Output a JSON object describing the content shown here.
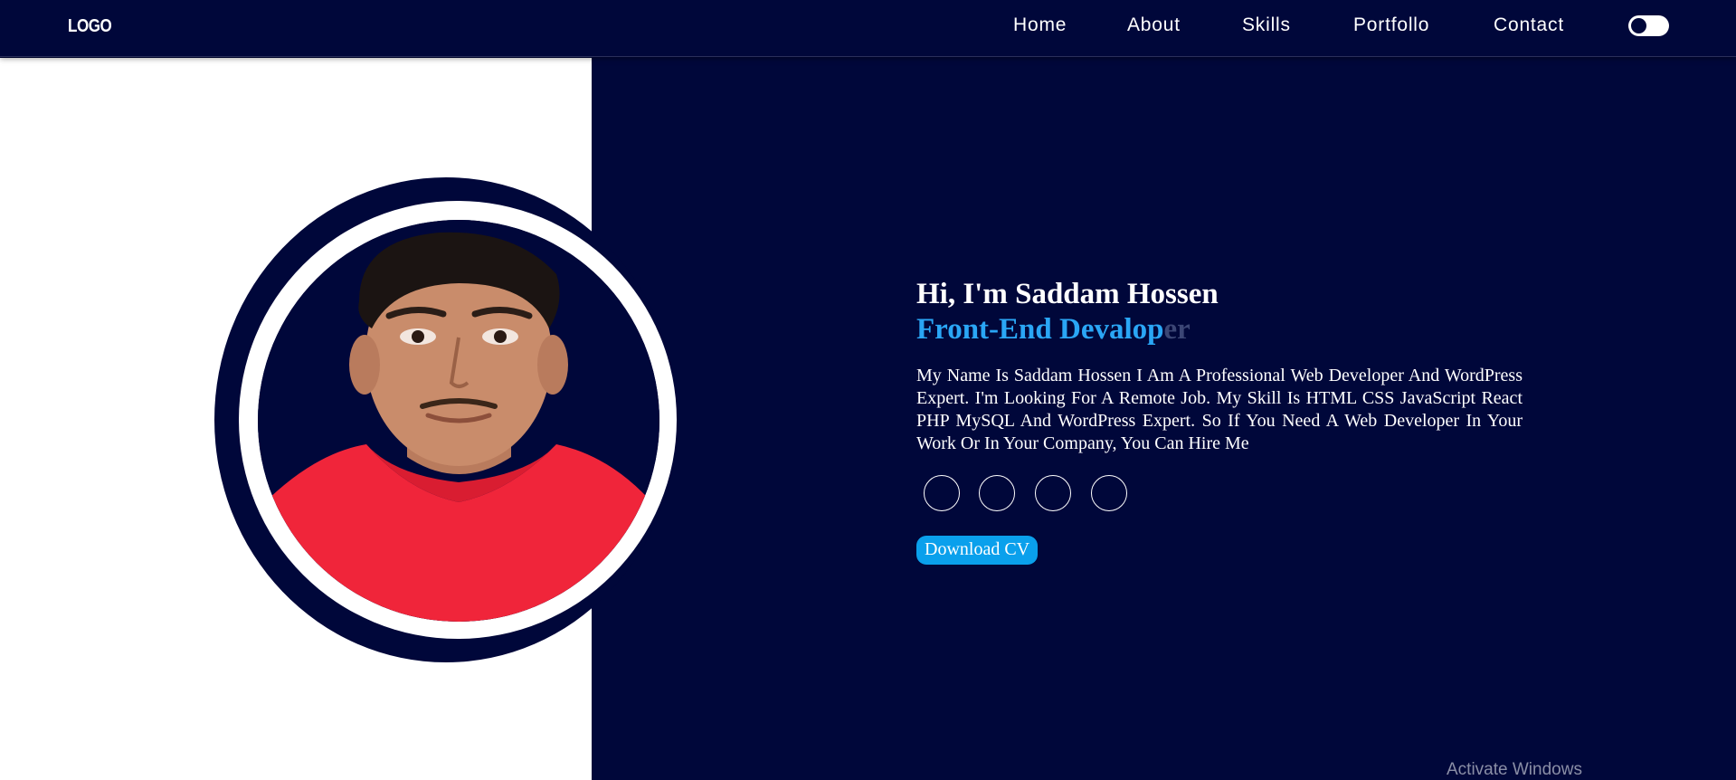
{
  "nav": {
    "logo": "LOGO",
    "links": [
      "Home",
      "About",
      "Skills",
      "Portfollo",
      "Contact"
    ],
    "theme_toggle_icon": "toggle-switch-icon"
  },
  "hero": {
    "greeting": "Hi, I'm Saddam Hossen",
    "role_typed": "Front-End Devalop",
    "role_faded": "er",
    "bio": "My Name Is Saddam Hossen I Am A Professional Web Developer And WordPress Expert. I'm Looking For A Remote Job. My Skill Is HTML CSS JavaScript React PHP MySQL And WordPress Expert. So If You Need A Web Developer In Your Work Or In Your Company, You Can Hire Me",
    "social_icons": [
      "social-icon",
      "social-icon",
      "social-icon",
      "social-icon"
    ],
    "cv_button": "Download CV"
  },
  "colors": {
    "navy": "#00073a",
    "accent_blue": "#0aa0ec",
    "role_blue": "#2aa6f5",
    "white": "#ffffff"
  },
  "os_overlay": {
    "watermark": "Activate Windows"
  }
}
